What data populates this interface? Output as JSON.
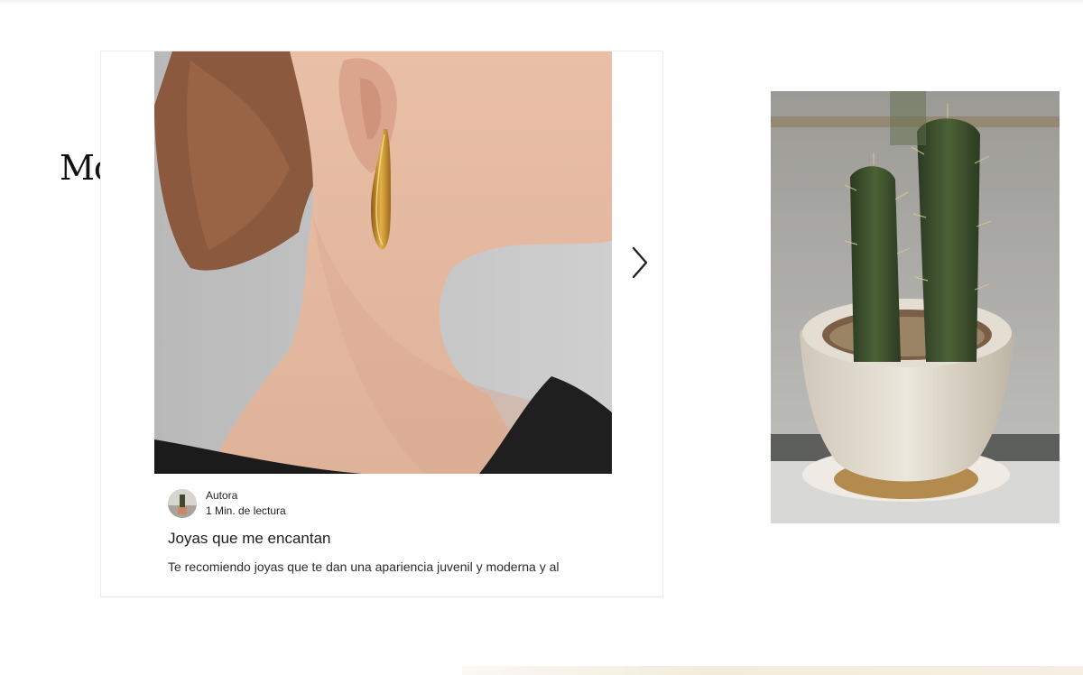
{
  "section": {
    "title": "Moda"
  },
  "post": {
    "author": "Autora",
    "read_time": "1 Min. de lectura",
    "title": "Joyas que me encantan",
    "excerpt": "Te recomiendo joyas que te dan una apariencia juvenil y moderna y al"
  },
  "icons": {
    "next": "chevron-right-icon"
  }
}
